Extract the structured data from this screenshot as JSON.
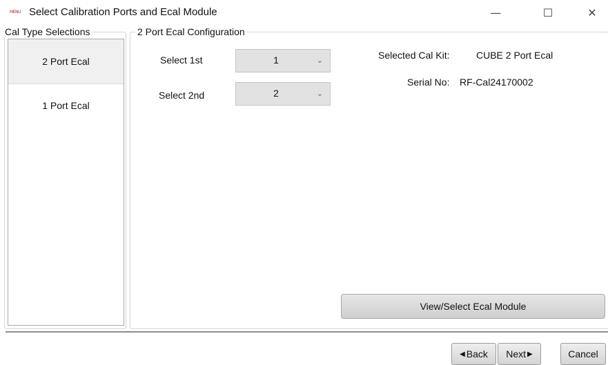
{
  "window": {
    "icon_text": "MENU",
    "title": "Select Calibration Ports and Ecal Module",
    "minimize_glyph": "—",
    "maximize_glyph": "☐",
    "close_glyph": "✕"
  },
  "cal_type": {
    "legend": "Cal Type Selections",
    "items": [
      {
        "label": "2 Port Ecal",
        "selected": true
      },
      {
        "label": "1 Port Ecal",
        "selected": false
      }
    ]
  },
  "config": {
    "legend": "2 Port Ecal Configuration",
    "select_1st": {
      "label": "Select 1st",
      "value": "1"
    },
    "select_2nd": {
      "label": "Select 2nd",
      "value": "2"
    },
    "cal_kit_label": "Selected Cal Kit:",
    "cal_kit_value": "CUBE 2 Port Ecal",
    "serial_label": "Serial No:",
    "serial_value": "RF-Cal24170002",
    "ecal_button": "View/Select Ecal Module"
  },
  "nav": {
    "back_arrow": "◀",
    "back": "Back",
    "next": "Next",
    "next_arrow": "▶",
    "cancel": "Cancel"
  },
  "icons": {
    "dropdown": "chevron-down-icon",
    "back": "triangle-left-icon",
    "next": "triangle-right-icon"
  }
}
